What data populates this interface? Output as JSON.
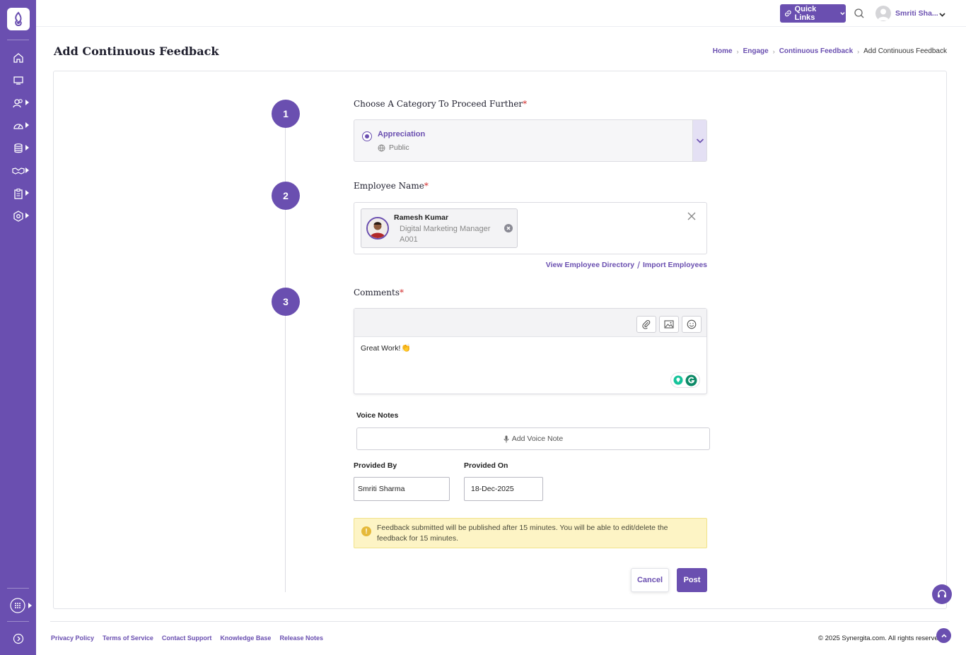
{
  "topbar": {
    "quick_links_label": "Quick Links",
    "user_name": "Smriti Sha..."
  },
  "page": {
    "title": "Add Continuous Feedback"
  },
  "breadcrumb": {
    "items": [
      "Home",
      "Engage",
      "Continuous Feedback"
    ],
    "current": "Add Continuous Feedback"
  },
  "steps": {
    "step1": {
      "number": "1",
      "label": "Choose A Category To Proceed Further",
      "required_mark": "*",
      "category_name": "Appreciation",
      "category_visibility": "Public"
    },
    "step2": {
      "number": "2",
      "label": "Employee Name",
      "required_mark": "*",
      "employee": {
        "name": "Ramesh Kumar",
        "designation": "Digital Marketing Manager",
        "code": "A001"
      },
      "links": {
        "directory": "View Employee Directory",
        "separator": "/",
        "import": "Import Employees"
      }
    },
    "step3": {
      "number": "3",
      "label": "Comments",
      "required_mark": "*",
      "comment_text": "Great Work!",
      "comment_emoji": "👏"
    }
  },
  "voice_notes": {
    "label": "Voice Notes",
    "button": "Add Voice Note"
  },
  "provided_by": {
    "label": "Provided By",
    "value": "Smriti Sharma"
  },
  "provided_on": {
    "label": "Provided On",
    "value": "18-Dec-2025"
  },
  "notice": {
    "icon": "!",
    "text": "Feedback submitted will be published after 15 minutes. You will be able to edit/delete the feedback for 15 minutes."
  },
  "actions": {
    "cancel": "Cancel",
    "post": "Post"
  },
  "footer": {
    "links": [
      "Privacy Policy",
      "Terms of Service",
      "Contact Support",
      "Knowledge Base",
      "Release Notes"
    ],
    "copyright": "© 2025 Synergita.com. All rights reserved."
  },
  "colors": {
    "brand": "#6a4fb0",
    "required": "#d32f2f",
    "notice_bg": "#fdf4c5"
  },
  "icons": {
    "sidebar": [
      "home-icon",
      "monitor-icon",
      "people-icon",
      "dashboard-gauge-icon",
      "database-icon",
      "handshake-icon",
      "clipboard-icon",
      "settings-icon",
      "apps-grid-icon",
      "expand-icon"
    ],
    "toolbar": [
      "paperclip-icon",
      "image-icon",
      "emoji-icon"
    ]
  }
}
